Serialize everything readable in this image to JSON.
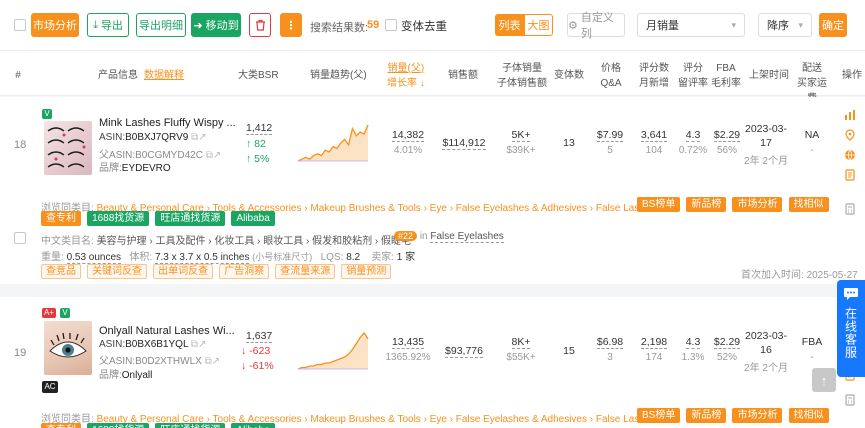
{
  "toolbar": {
    "market_analysis": "市场分析",
    "export": "导出",
    "export_detail": "导出明细",
    "move_to": "移动到",
    "result_count_label": "搜索结果数:",
    "result_count": "59",
    "dedupe_label": "变体去重",
    "view_list": "列表",
    "view_grid": "大图",
    "custom_columns": "自定义列",
    "sort_field": "月销量",
    "sort_order": "降序",
    "confirm": "确定"
  },
  "header": {
    "index": "#",
    "product_info": "产品信息",
    "data_explain": "数据解释",
    "bsr": "大类BSR",
    "sales_trend": "销量趋势(父)",
    "sales_parent": "销量(父)",
    "growth": "增长率",
    "revenue": "销售额",
    "child_sales": "子体销量",
    "child_revenue": "子体销售额",
    "variants": "变体数",
    "price": "价格",
    "qa": "Q&A",
    "ratings": "评分数",
    "monthly_new": "月新增",
    "rating": "评分",
    "review_rate": "留评率",
    "fba": "FBA",
    "margin": "毛利率",
    "listed_time": "上架时间",
    "delivery": "配送",
    "buyer_shipping": "买家运费",
    "actions": "操作"
  },
  "rows": [
    {
      "index": "18",
      "badges": [
        "V"
      ],
      "title": "Mink Lashes Fluffy Wispy ...",
      "asin_label": "ASIN:",
      "asin": "B0BXJ7QRV9",
      "parent_asin_label": "父ASIN:",
      "parent_asin": "B0CGMYD42C",
      "brand_label": "品牌:",
      "brand": "EYDEVRO",
      "bsr": "1,412",
      "bsr_change": "82",
      "bsr_pct": "5%",
      "bsr_dir": "up",
      "sales": "14,382",
      "growth": "4.01%",
      "revenue": "$114,912",
      "child_sales": "5K+",
      "child_revenue": "$39K+",
      "variants": "13",
      "price": "$7.99",
      "qa": "5",
      "ratings": "3,641",
      "monthly_new": "104",
      "rating": "4.3",
      "review_rate": "0.72%",
      "fba": "$2.29",
      "margin": "56%",
      "listed_date": "2023-03-17",
      "listed_age": "2年 2个月",
      "delivery": "NA",
      "buyer_shipping": "-",
      "trend": [
        10,
        11,
        12,
        11,
        13,
        14,
        13,
        16,
        15,
        18,
        17,
        20,
        22,
        19,
        28,
        24,
        26,
        25,
        30
      ]
    },
    {
      "index": "19",
      "badges": [
        "A+",
        "V"
      ],
      "bottom_badge": "AC",
      "title": "Onlyall Natural Lashes Wi...",
      "asin_label": "ASIN:",
      "asin": "B0BX6B1YQL",
      "parent_asin_label": "父ASIN:",
      "parent_asin": "B0D2XTHWLX",
      "brand_label": "品牌:",
      "brand": "Onlyall",
      "bsr": "1,637",
      "bsr_change": "-623",
      "bsr_pct": "-61%",
      "bsr_dir": "down",
      "sales": "13,435",
      "growth": "1365.92%",
      "revenue": "$93,776",
      "child_sales": "8K+",
      "child_revenue": "$55K+",
      "variants": "15",
      "price": "$6.98",
      "qa": "3",
      "ratings": "2,198",
      "monthly_new": "174",
      "rating": "4.3",
      "review_rate": "1.3%",
      "fba": "$2.29",
      "margin": "52%",
      "listed_date": "2023-03-16",
      "listed_age": "2年 2个月",
      "delivery": "FBA",
      "buyer_shipping": "-",
      "trend": [
        4,
        5,
        5,
        6,
        6,
        7,
        7,
        8,
        8,
        9,
        10,
        11,
        12,
        14,
        17,
        21,
        25,
        28,
        24
      ]
    }
  ],
  "detail": {
    "browse_label": "浏览同类目:",
    "browse_path": "Beauty & Personal Care › Tools & Accessories › Makeup Brushes & Tools › Eye › False Eyelashes & Adhesives › False Lashes",
    "btn_bs": "BS榜单",
    "btn_new": "新品榜",
    "btn_market": "市场分析",
    "btn_similar": "找相似",
    "btn_patent": "查专利",
    "btn_1688": "1688找货源",
    "btn_wangdian": "旺店通找货源",
    "btn_alibaba": "Alibaba",
    "cn_category_label": "中文类目名:",
    "cn_category": "美容与护理 › 工具及配件 › 化妆工具 › 眼妆工具 › 假发和胶粘剂 › 假睫毛",
    "rank_badge": "#22",
    "rank_in": "in",
    "rank_category": "False Eyelashes",
    "weight_label": "重量:",
    "weight": "0.53 ounces",
    "size_label": "体积:",
    "size": "7.3 x 3.7 x 0.5 inches",
    "size_note": "(小号标准尺寸)",
    "lqs_label": "LQS:",
    "lqs": "8.2",
    "sellers_label": "卖家:",
    "sellers": "1 家",
    "t_competitor": "查竞品",
    "t_keyword": "关键词反查",
    "t_order": "出单词反查",
    "t_ads": "广告洞察",
    "t_traffic": "查流量来源",
    "t_forecast": "销量预测",
    "first_added_label": "首次加入时间:",
    "first_added": "2025-05-27"
  },
  "chat": {
    "label": "在线客服"
  },
  "colors": {
    "orange": "#f8901d",
    "green": "#1aa563",
    "red": "#e4393c",
    "blue": "#1677ff"
  }
}
